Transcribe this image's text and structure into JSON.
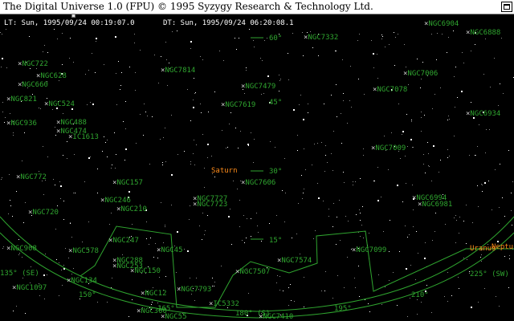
{
  "window": {
    "title": "The Digital Universe 1.0 (FPU) © 1995 Syzygy Research & Technology Ltd."
  },
  "status": {
    "local_time": "LT: Sun, 1995/09/24 00:19:07.0",
    "dynamical_time": "DT: Sun, 1995/09/24 06:20:08.1"
  },
  "colors": {
    "background": "#000000",
    "labels": "#2fa52f",
    "planet": "#ff8c1a",
    "stars": "#ffffff",
    "titlebar": "#ffffff"
  },
  "objects": [
    {
      "name": "NGC7332"
    },
    {
      "name": "NGC7814"
    },
    {
      "name": "NGC7479"
    },
    {
      "name": "NGC7619"
    },
    {
      "name": "NGC7078"
    },
    {
      "name": "NGC7006"
    },
    {
      "name": "NGC6934"
    },
    {
      "name": "NGC7009"
    },
    {
      "name": "NGC722"
    },
    {
      "name": "NGC628"
    },
    {
      "name": "NGC660"
    },
    {
      "name": "NGC821"
    },
    {
      "name": "NGC524"
    },
    {
      "name": "NGC488"
    },
    {
      "name": "NGC474"
    },
    {
      "name": "IC1613"
    },
    {
      "name": "NGC936"
    },
    {
      "name": "NGC772"
    },
    {
      "name": "NGC157"
    },
    {
      "name": "NGC7606"
    },
    {
      "name": "NGC246"
    },
    {
      "name": "NGC210"
    },
    {
      "name": "NGC7727"
    },
    {
      "name": "NGC7723"
    },
    {
      "name": "NGC720"
    },
    {
      "name": "NGC247"
    },
    {
      "name": "NGC45"
    },
    {
      "name": "NGC288"
    },
    {
      "name": "NGC253"
    },
    {
      "name": "NGC150"
    },
    {
      "name": "NGC7574"
    },
    {
      "name": "NGC7099"
    },
    {
      "name": "NGC7507"
    },
    {
      "name": "NGC7793"
    },
    {
      "name": "NGC578"
    },
    {
      "name": "NGC908"
    },
    {
      "name": "NGC1097"
    },
    {
      "name": "NGC134"
    },
    {
      "name": "NGC12"
    },
    {
      "name": "NGC300"
    },
    {
      "name": "NGC55"
    },
    {
      "name": "IC5332"
    },
    {
      "name": "NGC7410"
    },
    {
      "name": "NGC6981"
    },
    {
      "name": "NGC6994"
    },
    {
      "name": "NGC6888"
    },
    {
      "name": "NGC6904"
    }
  ],
  "planets": [
    {
      "name": "Saturn"
    },
    {
      "name": "Uranus"
    },
    {
      "name": "Neptune"
    }
  ],
  "altitude_marks": [
    {
      "label": "60°",
      "value": 60
    },
    {
      "label": "45°",
      "value": 45
    },
    {
      "label": "30°",
      "value": 30
    },
    {
      "label": "15°",
      "value": 15
    }
  ],
  "azimuth_marks": [
    {
      "label": "135° (SE)"
    },
    {
      "label": "150°"
    },
    {
      "label": "165°"
    },
    {
      "label": "180° (S)"
    },
    {
      "label": "195°"
    },
    {
      "label": "210°"
    },
    {
      "label": "225° (SW)"
    }
  ]
}
